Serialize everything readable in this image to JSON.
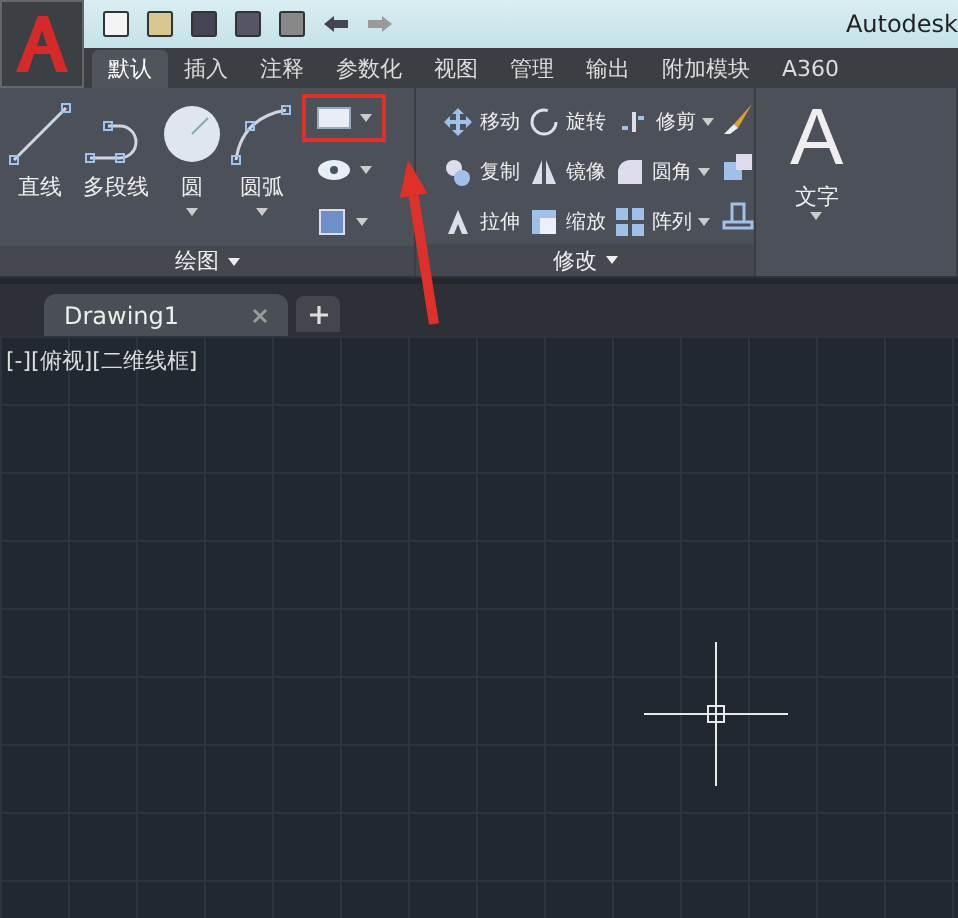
{
  "title_bar": {
    "title": "Autodesk"
  },
  "tabs": [
    {
      "label": "默认",
      "selected": true
    },
    {
      "label": "插入",
      "selected": false
    },
    {
      "label": "注释",
      "selected": false
    },
    {
      "label": "参数化",
      "selected": false
    },
    {
      "label": "视图",
      "selected": false
    },
    {
      "label": "管理",
      "selected": false
    },
    {
      "label": "输出",
      "selected": false
    },
    {
      "label": "附加模块",
      "selected": false
    },
    {
      "label": "A360",
      "selected": false
    }
  ],
  "draw_panel": {
    "title": "绘图",
    "large_tools": [
      {
        "label": "直线",
        "dropdown": false
      },
      {
        "label": "多段线",
        "dropdown": false
      },
      {
        "label": "圆",
        "dropdown": true
      },
      {
        "label": "圆弧",
        "dropdown": true
      }
    ],
    "small_tools": [
      {
        "highlighted": true
      },
      {
        "highlighted": false
      },
      {
        "highlighted": false
      }
    ]
  },
  "modify_panel": {
    "title": "修改",
    "tools": [
      {
        "label": "移动",
        "dropdown": false
      },
      {
        "label": "旋转",
        "dropdown": false
      },
      {
        "label": "修剪",
        "dropdown": true
      },
      {
        "label": "复制",
        "dropdown": false
      },
      {
        "label": "镜像",
        "dropdown": false
      },
      {
        "label": "圆角",
        "dropdown": true
      },
      {
        "label": "拉伸",
        "dropdown": false
      },
      {
        "label": "缩放",
        "dropdown": false
      },
      {
        "label": "阵列",
        "dropdown": true
      }
    ]
  },
  "text_panel": {
    "glyph": "A",
    "label": "文字"
  },
  "document_tabs": [
    {
      "label": "Drawing1",
      "selected": true
    }
  ],
  "viewport": {
    "label": "[-][俯视][二维线框]"
  }
}
